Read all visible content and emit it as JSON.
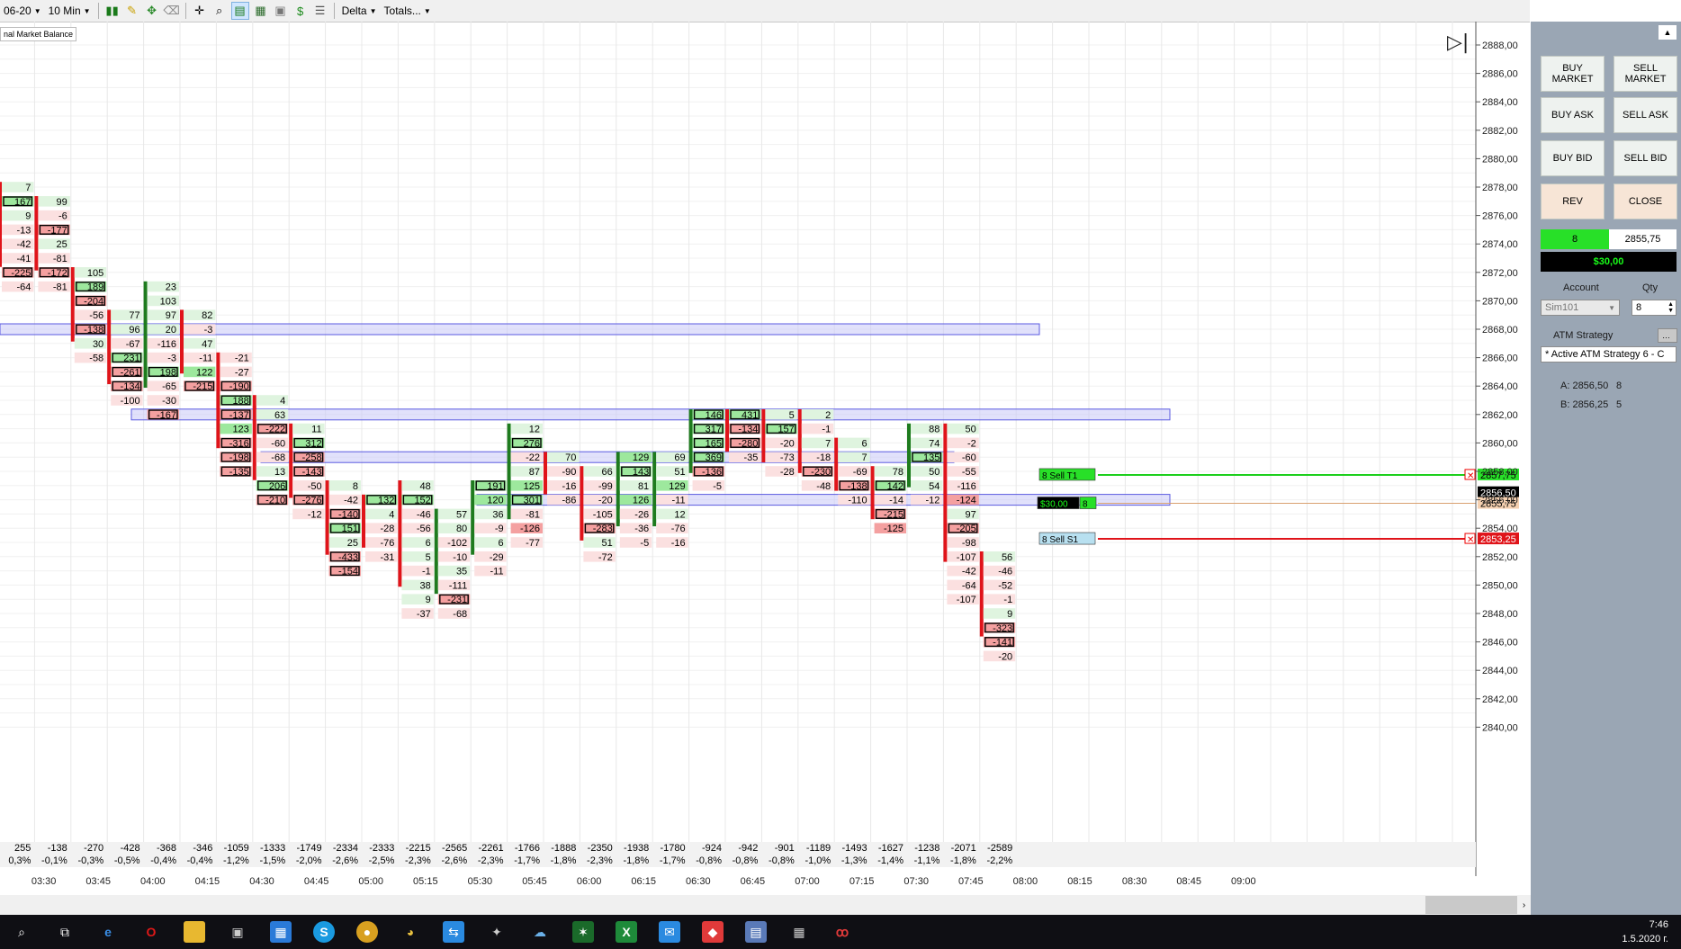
{
  "toolbar": {
    "instrument": "06-20",
    "timeframe": "10 Min",
    "study": "Delta",
    "totals": "Totals..."
  },
  "indicator_label": "nal Market Balance",
  "colors": {
    "buy_bar": "#1e7b1e",
    "sell_bar": "#e0141a",
    "pos_cell": "#dff4df",
    "neg_cell": "#fbe0e0",
    "strong_pos": "#9de89d",
    "strong_neg": "#f4a0a0",
    "balance_band": "#c8c8f8",
    "target_line": "#1ccf1c",
    "stop_line": "#e0141a",
    "avg_line": "#d9a070"
  },
  "price_axis": [
    "2888,00",
    "2886,00",
    "2884,00",
    "2882,00",
    "2880,00",
    "2878,00",
    "2876,00",
    "2874,00",
    "2872,00",
    "2870,00",
    "2868,00",
    "2866,00",
    "2864,00",
    "2862,00",
    "2860,00",
    "2858,00",
    "2856,00",
    "2854,00",
    "2852,00",
    "2850,00",
    "2848,00",
    "2846,00",
    "2844,00",
    "2842,00",
    "2840,00"
  ],
  "time_axis": [
    "03:30",
    "03:45",
    "04:00",
    "04:15",
    "04:30",
    "04:45",
    "05:00",
    "05:15",
    "05:30",
    "05:45",
    "06:00",
    "06:15",
    "06:30",
    "06:45",
    "07:00",
    "07:15",
    "07:30",
    "07:45",
    "08:00",
    "08:15",
    "08:30",
    "08:45",
    "09:00"
  ],
  "price_flags": {
    "target": "2857,75",
    "last": "2856,50",
    "avg": "2855,75",
    "stop": "2853,25"
  },
  "orders": {
    "target": {
      "qty": "8",
      "label": "Sell T1"
    },
    "stop": {
      "qty": "8",
      "label": "Sell S1"
    },
    "pnl_tag": "$30,00",
    "pnl_qty": "8"
  },
  "bars": [
    {
      "col": 0,
      "partial": true,
      "dir": "sell",
      "cells": [
        {
          "p": 2878.0,
          "v": "7"
        },
        {
          "p": 2877.0,
          "v": "167"
        },
        {
          "p": 2876.0,
          "v": "9"
        },
        {
          "p": 2875.0,
          "v": "-13"
        },
        {
          "p": 2874.0,
          "v": "-42"
        },
        {
          "p": 2873.0,
          "v": "-41"
        },
        {
          "p": 2872.0,
          "v": "-225"
        },
        {
          "p": 2871.0,
          "v": "-64"
        }
      ]
    },
    {
      "col": 1,
      "dir": "sell",
      "cells": [
        {
          "p": 2877.0,
          "v": "99"
        },
        {
          "p": 2876.0,
          "v": "-6"
        },
        {
          "p": 2875.0,
          "v": "-177"
        },
        {
          "p": 2874.0,
          "v": "25"
        },
        {
          "p": 2873.0,
          "v": "-81"
        },
        {
          "p": 2872.0,
          "v": "-172"
        },
        {
          "p": 2871.0,
          "v": "-81"
        }
      ]
    },
    {
      "col": 2,
      "dir": "sell",
      "cells": [
        {
          "p": 2872.0,
          "v": "105"
        },
        {
          "p": 2871.0,
          "v": "189"
        },
        {
          "p": 2870.0,
          "v": "-204"
        },
        {
          "p": 2869.0,
          "v": "-56"
        },
        {
          "p": 2868.0,
          "v": "-138"
        },
        {
          "p": 2867.0,
          "v": "30"
        },
        {
          "p": 2866.0,
          "v": "-58"
        }
      ]
    },
    {
      "col": 3,
      "dir": "sell",
      "cells": [
        {
          "p": 2869.0,
          "v": "77"
        },
        {
          "p": 2868.0,
          "v": "96"
        },
        {
          "p": 2867.0,
          "v": "-67"
        },
        {
          "p": 2866.0,
          "v": "231"
        },
        {
          "p": 2865.0,
          "v": "-261"
        },
        {
          "p": 2864.0,
          "v": "-134"
        },
        {
          "p": 2863.0,
          "v": "-100"
        }
      ]
    },
    {
      "col": 4,
      "dir": "buy",
      "cells": [
        {
          "p": 2871.0,
          "v": "23"
        },
        {
          "p": 2870.0,
          "v": "103"
        },
        {
          "p": 2869.0,
          "v": "97"
        },
        {
          "p": 2868.0,
          "v": "20"
        },
        {
          "p": 2867.0,
          "v": "-116"
        },
        {
          "p": 2866.0,
          "v": "-3"
        },
        {
          "p": 2865.0,
          "v": "198"
        },
        {
          "p": 2864.0,
          "v": "-65"
        },
        {
          "p": 2863.0,
          "v": "-30"
        },
        {
          "p": 2862.0,
          "v": "-167"
        }
      ]
    },
    {
      "col": 5,
      "dir": "sell",
      "cells": [
        {
          "p": 2869.0,
          "v": "82"
        },
        {
          "p": 2868.0,
          "v": "-3"
        },
        {
          "p": 2867.0,
          "v": "47"
        },
        {
          "p": 2866.0,
          "v": "-11"
        },
        {
          "p": 2865.0,
          "v": "122"
        },
        {
          "p": 2864.0,
          "v": "-215"
        }
      ]
    },
    {
      "col": 6,
      "dir": "sell",
      "cells": [
        {
          "p": 2866.0,
          "v": "-21"
        },
        {
          "p": 2865.0,
          "v": "-27"
        },
        {
          "p": 2864.0,
          "v": "-190"
        },
        {
          "p": 2863.0,
          "v": "188"
        },
        {
          "p": 2862.0,
          "v": "-137"
        },
        {
          "p": 2861.0,
          "v": "123"
        },
        {
          "p": 2860.0,
          "v": "-316"
        },
        {
          "p": 2859.0,
          "v": "-198"
        },
        {
          "p": 2858.0,
          "v": "-135"
        }
      ]
    },
    {
      "col": 7,
      "dir": "sell",
      "cells": [
        {
          "p": 2863.0,
          "v": "4"
        },
        {
          "p": 2862.0,
          "v": "63"
        },
        {
          "p": 2861.0,
          "v": "-222"
        },
        {
          "p": 2860.0,
          "v": "-60"
        },
        {
          "p": 2859.0,
          "v": "-68"
        },
        {
          "p": 2858.0,
          "v": "13"
        },
        {
          "p": 2857.0,
          "v": "206"
        },
        {
          "p": 2856.0,
          "v": "-210"
        }
      ]
    },
    {
      "col": 8,
      "dir": "sell",
      "cells": [
        {
          "p": 2861.0,
          "v": "11"
        },
        {
          "p": 2860.0,
          "v": "312"
        },
        {
          "p": 2859.0,
          "v": "-258"
        },
        {
          "p": 2858.0,
          "v": "-143"
        },
        {
          "p": 2857.0,
          "v": "-50"
        },
        {
          "p": 2856.0,
          "v": "-276"
        },
        {
          "p": 2855.0,
          "v": "-12"
        }
      ]
    },
    {
      "col": 9,
      "dir": "sell",
      "cells": [
        {
          "p": 2857.0,
          "v": "8"
        },
        {
          "p": 2856.0,
          "v": "-42"
        },
        {
          "p": 2855.0,
          "v": "-140"
        },
        {
          "p": 2854.0,
          "v": "151"
        },
        {
          "p": 2853.0,
          "v": "25"
        },
        {
          "p": 2852.0,
          "v": "-433"
        },
        {
          "p": 2851.0,
          "v": "-154"
        }
      ]
    },
    {
      "col": 10,
      "dir": "sell",
      "cells": [
        {
          "p": 2856.0,
          "v": "132"
        },
        {
          "p": 2855.0,
          "v": "4"
        },
        {
          "p": 2854.0,
          "v": "-28"
        },
        {
          "p": 2853.0,
          "v": "-76"
        },
        {
          "p": 2852.0,
          "v": "-31"
        }
      ]
    },
    {
      "col": 11,
      "dir": "sell",
      "cells": [
        {
          "p": 2857.0,
          "v": "48"
        },
        {
          "p": 2856.0,
          "v": "152"
        },
        {
          "p": 2855.0,
          "v": "-46"
        },
        {
          "p": 2854.0,
          "v": "-56"
        },
        {
          "p": 2853.0,
          "v": "6"
        },
        {
          "p": 2852.0,
          "v": "5"
        },
        {
          "p": 2851.0,
          "v": "-1"
        },
        {
          "p": 2850.0,
          "v": "38"
        },
        {
          "p": 2849.0,
          "v": "9"
        },
        {
          "p": 2848.0,
          "v": "-37"
        }
      ]
    },
    {
      "col": 12,
      "dir": "buy",
      "cells": [
        {
          "p": 2855.0,
          "v": "57"
        },
        {
          "p": 2854.0,
          "v": "80"
        },
        {
          "p": 2853.0,
          "v": "-102"
        },
        {
          "p": 2852.0,
          "v": "-10"
        },
        {
          "p": 2851.0,
          "v": "35"
        },
        {
          "p": 2850.0,
          "v": "-111"
        },
        {
          "p": 2849.0,
          "v": "-231"
        },
        {
          "p": 2848.0,
          "v": "-68"
        }
      ]
    },
    {
      "col": 13,
      "dir": "buy",
      "cells": [
        {
          "p": 2857.0,
          "v": "191"
        },
        {
          "p": 2856.0,
          "v": "120"
        },
        {
          "p": 2855.0,
          "v": "36"
        },
        {
          "p": 2854.0,
          "v": "-9"
        },
        {
          "p": 2853.0,
          "v": "6"
        },
        {
          "p": 2852.0,
          "v": "-29"
        },
        {
          "p": 2851.0,
          "v": "-11"
        }
      ]
    },
    {
      "col": 14,
      "dir": "buy",
      "cells": [
        {
          "p": 2861.0,
          "v": "12"
        },
        {
          "p": 2860.0,
          "v": "276"
        },
        {
          "p": 2859.0,
          "v": "-22"
        },
        {
          "p": 2858.0,
          "v": "87"
        },
        {
          "p": 2857.0,
          "v": "125"
        },
        {
          "p": 2856.0,
          "v": "301"
        },
        {
          "p": 2855.0,
          "v": "-81"
        },
        {
          "p": 2854.0,
          "v": "-126"
        },
        {
          "p": 2853.0,
          "v": "-77"
        }
      ]
    },
    {
      "col": 15,
      "dir": "sell",
      "cells": [
        {
          "p": 2859.0,
          "v": "70"
        },
        {
          "p": 2858.0,
          "v": "-90"
        },
        {
          "p": 2857.0,
          "v": "-16"
        },
        {
          "p": 2856.0,
          "v": "-86"
        }
      ]
    },
    {
      "col": 16,
      "dir": "sell",
      "cells": [
        {
          "p": 2858.0,
          "v": "66"
        },
        {
          "p": 2857.0,
          "v": "-99"
        },
        {
          "p": 2856.0,
          "v": "-20"
        },
        {
          "p": 2855.0,
          "v": "-105"
        },
        {
          "p": 2854.0,
          "v": "-283"
        },
        {
          "p": 2853.0,
          "v": "51"
        },
        {
          "p": 2852.0,
          "v": "-72"
        }
      ]
    },
    {
      "col": 17,
      "dir": "buy",
      "cells": [
        {
          "p": 2859.0,
          "v": "129"
        },
        {
          "p": 2858.0,
          "v": "143"
        },
        {
          "p": 2857.0,
          "v": "81"
        },
        {
          "p": 2856.0,
          "v": "126"
        },
        {
          "p": 2855.0,
          "v": "-26"
        },
        {
          "p": 2854.0,
          "v": "-36"
        },
        {
          "p": 2853.0,
          "v": "-5"
        }
      ]
    },
    {
      "col": 18,
      "dir": "buy",
      "cells": [
        {
          "p": 2859.0,
          "v": "69"
        },
        {
          "p": 2858.0,
          "v": "51"
        },
        {
          "p": 2857.0,
          "v": "129"
        },
        {
          "p": 2856.0,
          "v": "-11"
        },
        {
          "p": 2855.0,
          "v": "12"
        },
        {
          "p": 2854.0,
          "v": "-76"
        },
        {
          "p": 2853.0,
          "v": "-16"
        }
      ]
    },
    {
      "col": 19,
      "dir": "buy",
      "cells": [
        {
          "p": 2862.0,
          "v": "146"
        },
        {
          "p": 2861.0,
          "v": "317"
        },
        {
          "p": 2860.0,
          "v": "165"
        },
        {
          "p": 2859.0,
          "v": "369"
        },
        {
          "p": 2858.0,
          "v": "-136"
        },
        {
          "p": 2857.0,
          "v": "-5"
        }
      ]
    },
    {
      "col": 20,
      "dir": "sell",
      "cells": [
        {
          "p": 2862.0,
          "v": "431"
        },
        {
          "p": 2861.0,
          "v": "-134"
        },
        {
          "p": 2860.0,
          "v": "-280"
        },
        {
          "p": 2859.0,
          "v": "-35"
        }
      ]
    },
    {
      "col": 21,
      "dir": "sell",
      "cells": [
        {
          "p": 2862.0,
          "v": "5"
        },
        {
          "p": 2861.0,
          "v": "157"
        },
        {
          "p": 2860.0,
          "v": "-20"
        },
        {
          "p": 2859.0,
          "v": "-73"
        },
        {
          "p": 2858.0,
          "v": "-28"
        }
      ]
    },
    {
      "col": 22,
      "dir": "sell",
      "cells": [
        {
          "p": 2862.0,
          "v": "2"
        },
        {
          "p": 2861.0,
          "v": "-1"
        },
        {
          "p": 2860.0,
          "v": "7"
        },
        {
          "p": 2859.0,
          "v": "-18"
        },
        {
          "p": 2858.0,
          "v": "-230"
        },
        {
          "p": 2857.0,
          "v": "-48"
        }
      ]
    },
    {
      "col": 23,
      "dir": "sell",
      "cells": [
        {
          "p": 2860.0,
          "v": "6"
        },
        {
          "p": 2859.0,
          "v": "7"
        },
        {
          "p": 2858.0,
          "v": "-69"
        },
        {
          "p": 2857.0,
          "v": "-138"
        },
        {
          "p": 2856.0,
          "v": "-110"
        }
      ]
    },
    {
      "col": 24,
      "dir": "sell",
      "cells": [
        {
          "p": 2858.0,
          "v": "78"
        },
        {
          "p": 2857.0,
          "v": "142"
        },
        {
          "p": 2856.0,
          "v": "-14"
        },
        {
          "p": 2855.0,
          "v": "-215"
        },
        {
          "p": 2854.0,
          "v": "-125"
        }
      ]
    },
    {
      "col": 25,
      "dir": "buy",
      "cells": [
        {
          "p": 2861.0,
          "v": "88"
        },
        {
          "p": 2860.0,
          "v": "74"
        },
        {
          "p": 2859.0,
          "v": "135"
        },
        {
          "p": 2858.0,
          "v": "50"
        },
        {
          "p": 2857.0,
          "v": "54"
        },
        {
          "p": 2856.0,
          "v": "-12"
        }
      ]
    },
    {
      "col": 26,
      "dir": "sell",
      "cells": [
        {
          "p": 2861.0,
          "v": "50"
        },
        {
          "p": 2860.0,
          "v": "-2"
        },
        {
          "p": 2859.0,
          "v": "-60"
        },
        {
          "p": 2858.0,
          "v": "-55"
        },
        {
          "p": 2857.0,
          "v": "-116"
        },
        {
          "p": 2856.0,
          "v": "-124"
        },
        {
          "p": 2855.0,
          "v": "97"
        },
        {
          "p": 2854.0,
          "v": "-205"
        },
        {
          "p": 2853.0,
          "v": "-98"
        },
        {
          "p": 2852.0,
          "v": "-107"
        },
        {
          "p": 2851.0,
          "v": "-42"
        },
        {
          "p": 2850.0,
          "v": "-64"
        },
        {
          "p": 2849.0,
          "v": "-107"
        }
      ]
    },
    {
      "col": 27,
      "dir": "sell",
      "cells": [
        {
          "p": 2852.0,
          "v": "56"
        },
        {
          "p": 2851.0,
          "v": "-46"
        },
        {
          "p": 2850.0,
          "v": "-52"
        },
        {
          "p": 2849.0,
          "v": "-1"
        },
        {
          "p": 2848.0,
          "v": "9"
        },
        {
          "p": 2847.0,
          "v": "-323"
        },
        {
          "p": 2846.0,
          "v": "-141"
        },
        {
          "p": 2845.0,
          "v": "-20"
        }
      ]
    }
  ],
  "totals_row": [
    "255",
    "-138",
    "-270",
    "-428",
    "-368",
    "-346",
    "-1059",
    "-1333",
    "-1749",
    "-2334",
    "-2333",
    "-2215",
    "-2565",
    "-2261",
    "-1766",
    "-1888",
    "-2350",
    "-1938",
    "-1780",
    "-924",
    "-942",
    "-901",
    "-1189",
    "-1493",
    "-1627",
    "-1238",
    "-2071",
    "-2589"
  ],
  "pct_row": [
    "0,3%",
    "-0,1%",
    "-0,3%",
    "-0,5%",
    "-0,4%",
    "-0,4%",
    "-1,2%",
    "-1,5%",
    "-2,0%",
    "-2,6%",
    "-2,5%",
    "-2,3%",
    "-2,6%",
    "-2,3%",
    "-1,7%",
    "-1,8%",
    "-2,3%",
    "-1,8%",
    "-1,7%",
    "-0,8%",
    "-0,8%",
    "-0,8%",
    "-1,0%",
    "-1,3%",
    "-1,4%",
    "-1,1%",
    "-1,8%",
    "-2,2%"
  ],
  "panel": {
    "buttons": [
      "BUY\nMARKET",
      "SELL\nMARKET",
      "BUY ASK",
      "SELL ASK",
      "BUY BID",
      "SELL BID",
      "REV",
      "CLOSE"
    ],
    "position_qty": "8",
    "position_price": "2855,75",
    "pnl": "$30,00",
    "account_label": "Account",
    "qty_label": "Qty",
    "account": "Sim101",
    "qty": "8",
    "atm_label": "ATM Strategy",
    "atm_value": "* Active ATM Strategy 6 - C",
    "ask_label": "A: 2856,50",
    "ask_qty": "8",
    "bid_label": "B: 2856,25",
    "bid_qty": "5"
  },
  "clock": {
    "time": "7:46",
    "date": "1.5.2020 г."
  }
}
